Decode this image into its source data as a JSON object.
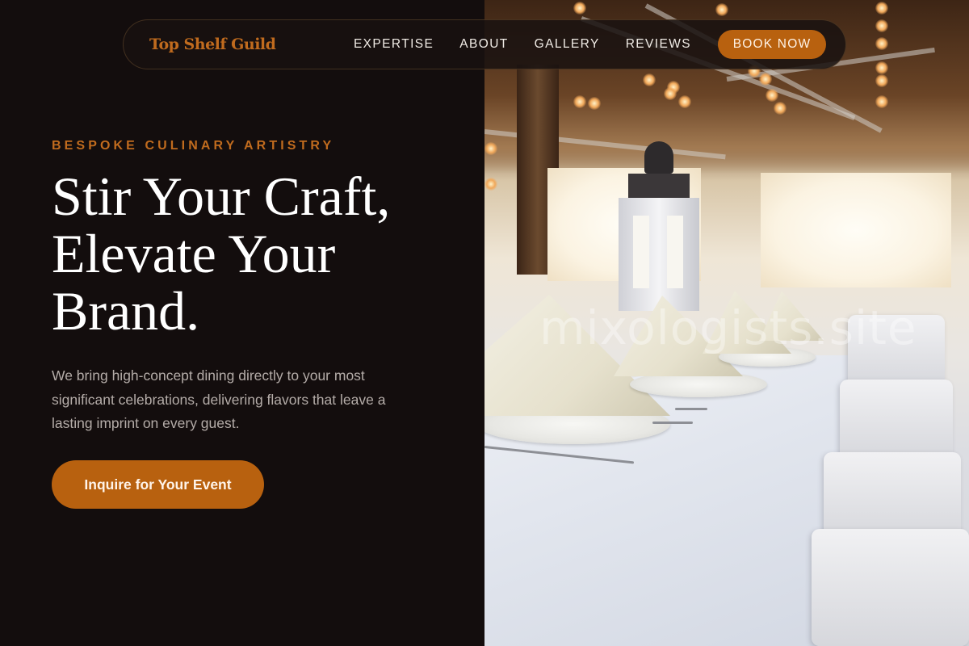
{
  "nav": {
    "brand": "Top Shelf Guild",
    "links": [
      "EXPERTISE",
      "ABOUT",
      "GALLERY",
      "REVIEWS"
    ],
    "cta_label": "BOOK NOW"
  },
  "hero": {
    "eyebrow": "BESPOKE CULINARY ARTISTRY",
    "headline": "Stir Your Craft, Elevate Your Brand.",
    "subtext": "We bring high-concept dining directly to your most significant celebrations, delivering flavors that leave a lasting imprint on every guest.",
    "cta_label": "Inquire for Your Event"
  },
  "photo": {
    "watermark": "mixologists.site"
  },
  "colors": {
    "accent": "#b8610f",
    "brand_text": "#c06b1e",
    "background": "#130d0d",
    "body_text": "#b4aca8"
  }
}
